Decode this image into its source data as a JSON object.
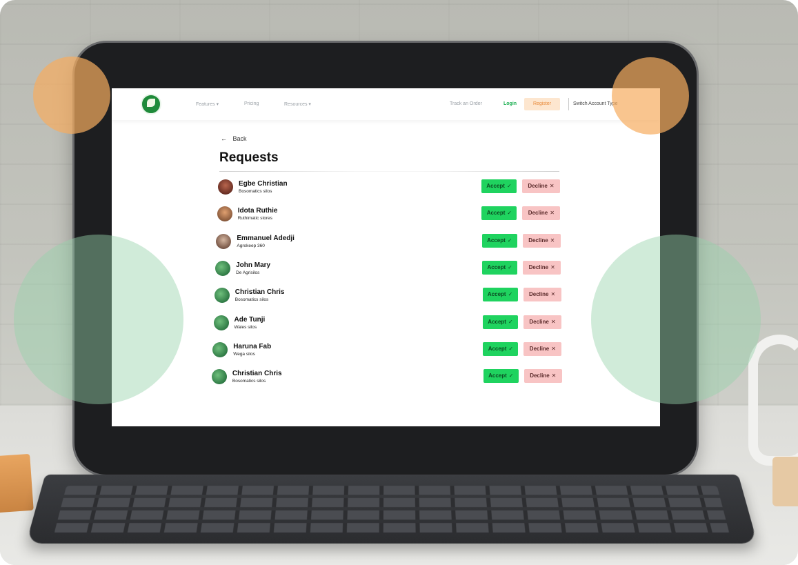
{
  "nav": {
    "links": [
      "Features ▾",
      "Pricing",
      "Resources ▾"
    ],
    "track_order": "Track an Order",
    "login": "Login",
    "register": "Register",
    "switch_account": "Switch Account Type"
  },
  "page": {
    "back_label": "Back",
    "title": "Requests"
  },
  "actions": {
    "accept_label": "Accept",
    "accept_icon": "✓",
    "decline_label": "Decline",
    "decline_icon": "✕"
  },
  "requests": [
    {
      "name": "Egbe Christian",
      "store": "Bosomatics silos",
      "avatar": "photo"
    },
    {
      "name": "Idota Ruthie",
      "store": "Ruthimatic stores",
      "avatar": "photo"
    },
    {
      "name": "Emmanuel Adedji",
      "store": "Agrokeep 360",
      "avatar": "photo"
    },
    {
      "name": "John Mary",
      "store": "De Agrisilos",
      "avatar": "placeholder"
    },
    {
      "name": "Christian Chris",
      "store": "Bosomatics silos",
      "avatar": "placeholder"
    },
    {
      "name": "Ade Tunji",
      "store": "Wales silos",
      "avatar": "placeholder"
    },
    {
      "name": "Haruna Fab",
      "store": "Wega silos",
      "avatar": "placeholder"
    },
    {
      "name": "Christian Chris",
      "store": "Bosomatics silos",
      "avatar": "placeholder"
    }
  ],
  "colors": {
    "accept": "#1fd35f",
    "decline": "#f8c4c4",
    "register": "#fde6cf",
    "login": "#1fb054",
    "brand": "#1f8a3a"
  }
}
